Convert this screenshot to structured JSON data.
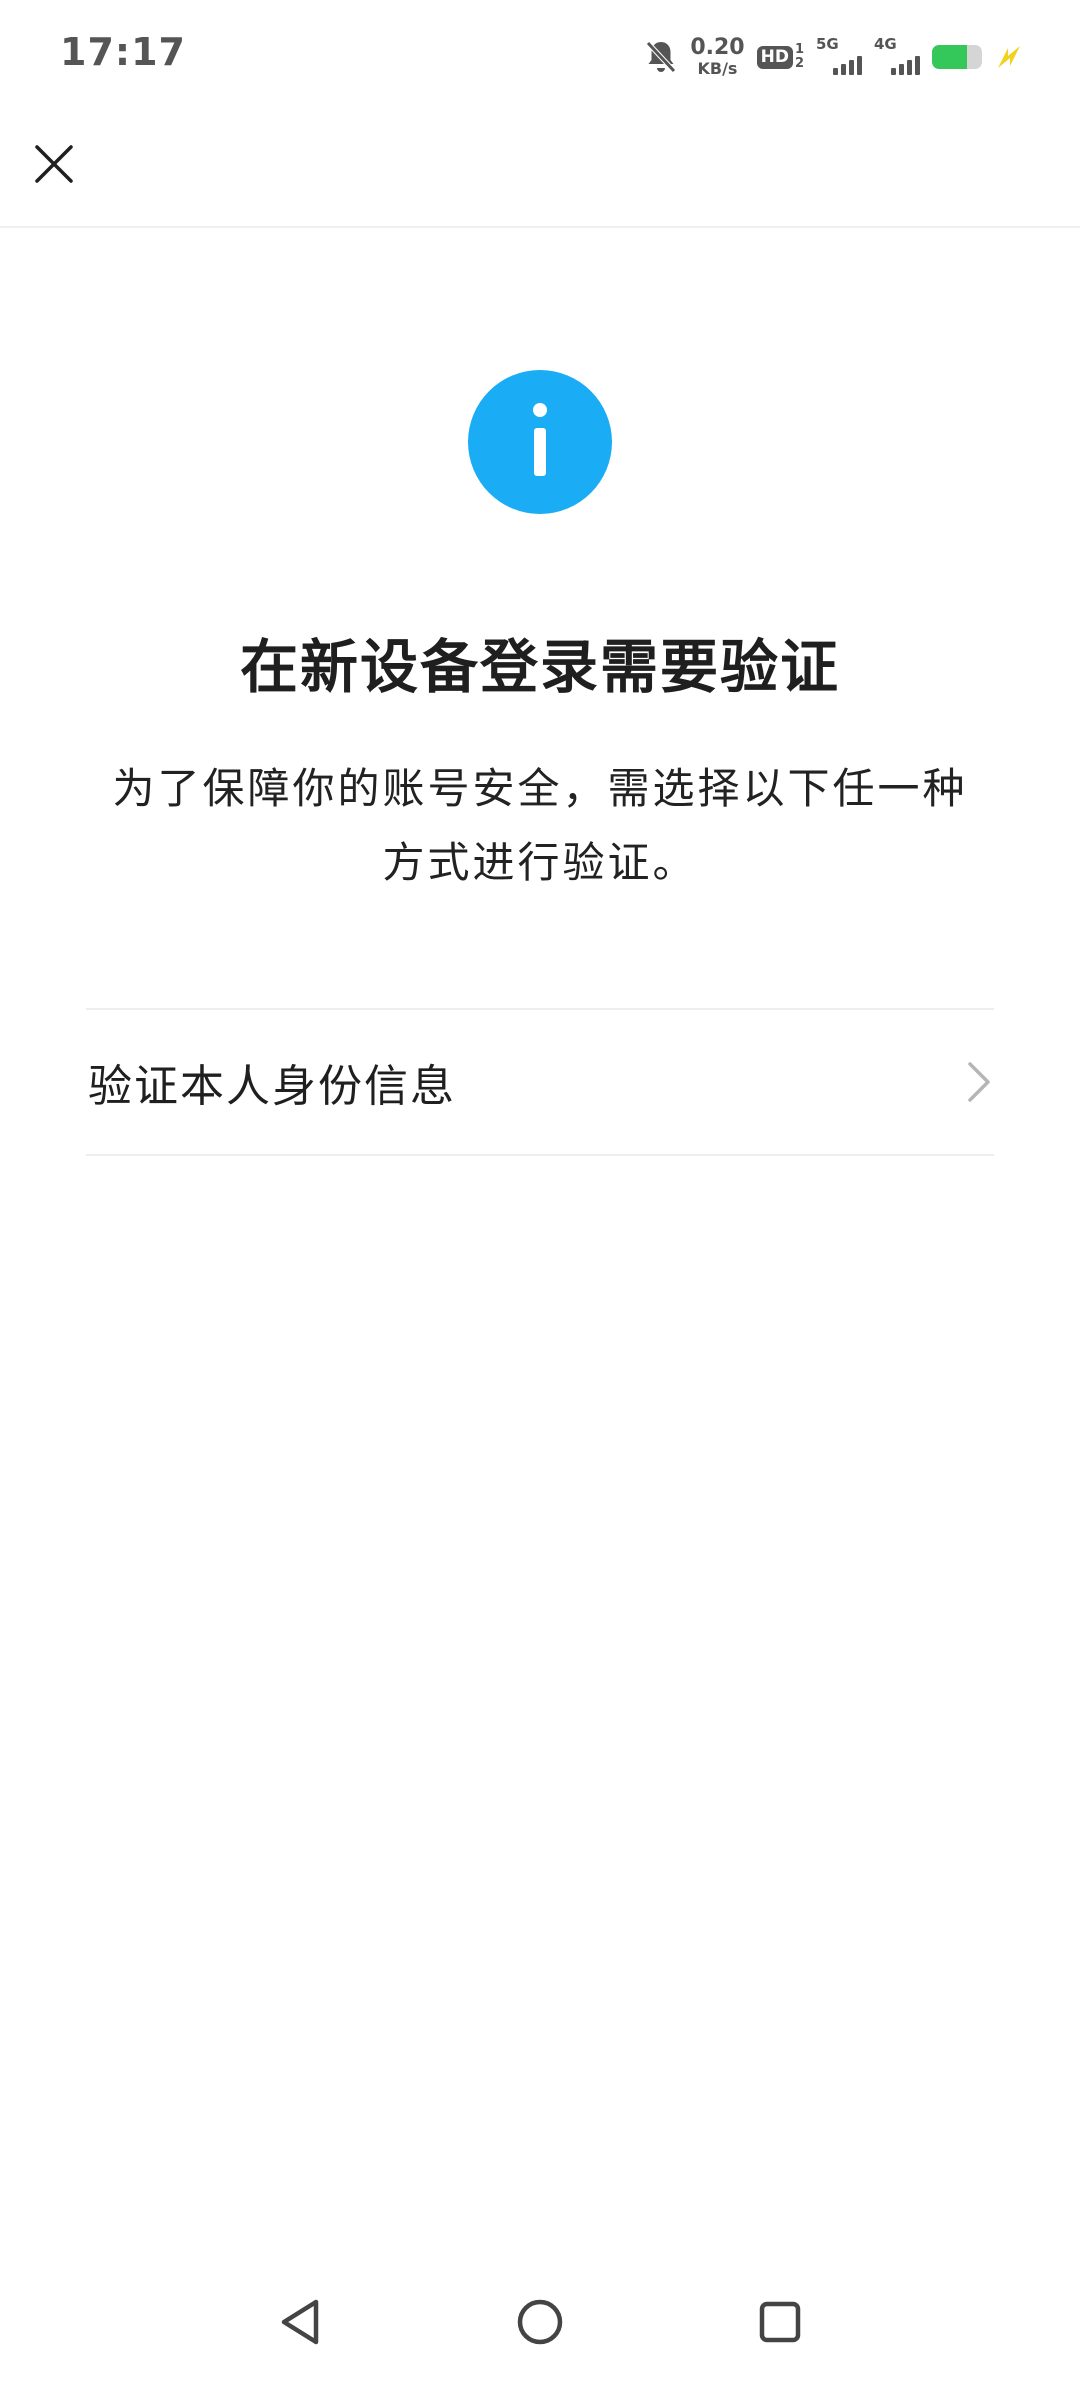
{
  "status_bar": {
    "time": "17:17",
    "net_speed_value": "0.20",
    "net_speed_unit": "KB/s",
    "hd_label": "HD",
    "hd_sim_top": "1",
    "hd_sim_bottom": "2",
    "signal_1_label": "5G",
    "signal_2_label": "4G",
    "battery_level": 0.7,
    "icons": [
      "bell-muted-icon",
      "hd-icon",
      "signal-icon",
      "battery-icon",
      "charging-icon"
    ],
    "colors": {
      "text": "#555555",
      "battery": "#34c759",
      "charging": "#f2d21b"
    }
  },
  "nav": {
    "close_icon": "close-icon"
  },
  "header": {
    "info_icon": "info-icon",
    "info_color": "#1aadf6",
    "title": "在新设备登录需要验证"
  },
  "description": {
    "line1": "为了保障你的账号安全，需选择以下任一种",
    "line2": "方式进行验证。"
  },
  "options": [
    {
      "label": "验证本人身份信息",
      "icon": "chevron-right-icon"
    }
  ],
  "system_nav": {
    "back_icon": "back-triangle-icon",
    "home_icon": "home-circle-icon",
    "recent_icon": "recent-square-icon"
  }
}
